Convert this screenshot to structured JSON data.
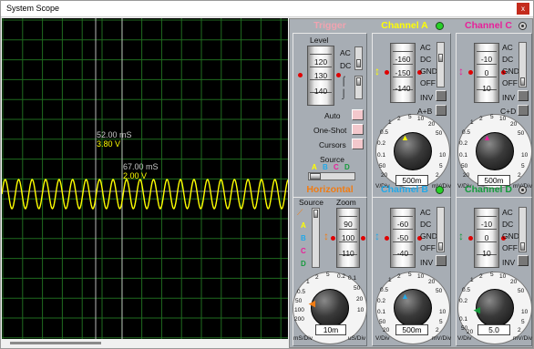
{
  "window": {
    "title": "System Scope",
    "close": "x"
  },
  "markers": [
    {
      "time": "52.00 mS",
      "volt": "3.80 V"
    },
    {
      "time": "67.00 mS",
      "volt": "2.00 V"
    }
  ],
  "trigger": {
    "title": "Trigger",
    "level_label": "Level",
    "level_ticks": [
      "120",
      "130",
      "140"
    ],
    "coupling": [
      "AC",
      "DC"
    ],
    "modes": [
      "Auto",
      "One-Shot",
      "Cursors"
    ],
    "source_label": "Source",
    "sources": [
      "A",
      "B",
      "C",
      "D"
    ]
  },
  "channel_a": {
    "title": "Channel A",
    "ticks": [
      "-160",
      "-150",
      "-140"
    ],
    "coupling": [
      "AC",
      "DC",
      "GND",
      "OFF"
    ],
    "inv": "INV",
    "combine": "A+B",
    "dial": [
      "0.5",
      "1",
      "2",
      "5",
      "10",
      "20",
      "50",
      "0.2",
      "0.1",
      "50",
      "20",
      "10",
      "5",
      "2"
    ],
    "value": "500m",
    "unit_left": "V/Div",
    "unit_right": "mV/Div"
  },
  "channel_b": {
    "title": "Channel B",
    "ticks": [
      "-60",
      "-50",
      "-40"
    ],
    "coupling": [
      "AC",
      "DC",
      "GND",
      "OFF"
    ],
    "inv": "INV",
    "dial": [
      "0.5",
      "1",
      "2",
      "5",
      "10",
      "20",
      "50",
      "0.2",
      "0.1",
      "50",
      "20",
      "10",
      "5",
      "2"
    ],
    "value": "500m",
    "unit_left": "V/Div",
    "unit_right": "mV/Div"
  },
  "channel_c": {
    "title": "Channel C",
    "ticks": [
      "-10",
      "0",
      "10"
    ],
    "coupling": [
      "AC",
      "DC",
      "GND",
      "OFF"
    ],
    "inv": "INV",
    "combine": "C+D",
    "dial": [
      "0.5",
      "1",
      "2",
      "5",
      "10",
      "20",
      "50",
      "0.2",
      "0.1",
      "50",
      "20",
      "10",
      "5",
      "2"
    ],
    "value": "500m",
    "unit_left": "V/Div",
    "unit_right": "mV/Div"
  },
  "channel_d": {
    "title": "Channel D",
    "ticks": [
      "-10",
      "0",
      "10"
    ],
    "coupling": [
      "AC",
      "DC",
      "GND",
      "OFF"
    ],
    "inv": "INV",
    "dial": [
      "0.5",
      "1",
      "2",
      "5",
      "10",
      "20",
      "50",
      "0.2",
      "0.1",
      "50",
      "20",
      "10",
      "5",
      "2"
    ],
    "value": "5.0",
    "unit_left": "V/Div",
    "unit_right": "mV/Div"
  },
  "horizontal": {
    "title": "Horizontal",
    "source_label": "Source",
    "zoom_label": "Zoom",
    "sources": [
      "A",
      "B",
      "C",
      "D"
    ],
    "ticks": [
      "90",
      "100",
      "110"
    ],
    "dial": [
      "0.5",
      "1",
      "2",
      "5",
      "10",
      "20",
      "50",
      "100",
      "200",
      "0.2",
      "0.1",
      "50",
      "20",
      "10"
    ],
    "value": "10m",
    "unit_left": "mS/Div",
    "unit_right": "uS/Div"
  },
  "colors": {
    "channel_a": "#ffff00",
    "channel_b": "#22a8e8",
    "channel_c": "#e8209a",
    "channel_d": "#159a3c",
    "horizontal": "#f07c14",
    "trigger": "#f0a3b0",
    "trace": "#ffff00"
  }
}
